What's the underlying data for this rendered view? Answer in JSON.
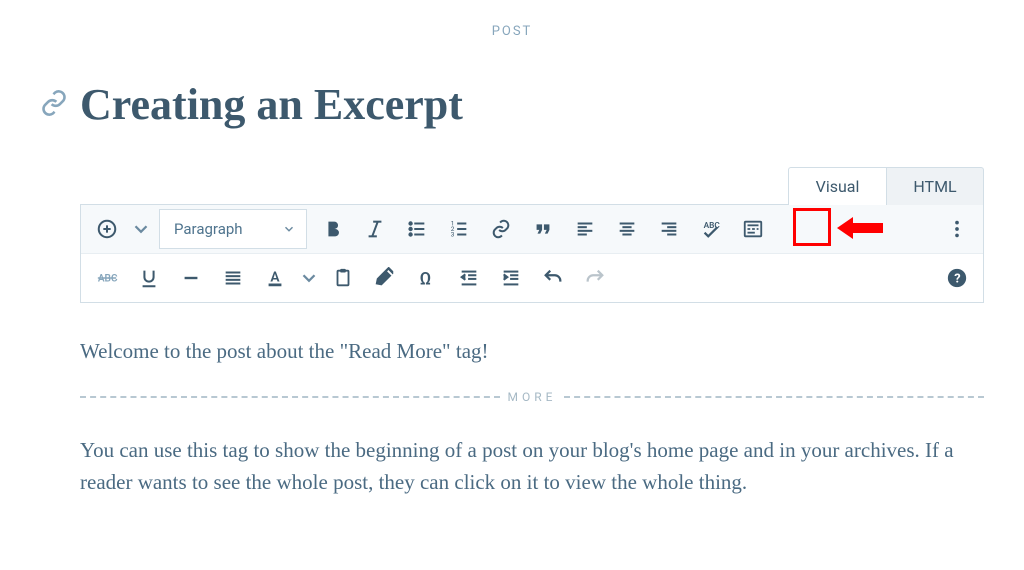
{
  "header": {
    "post_label": "POST"
  },
  "title": "Creating an Excerpt",
  "tabs": {
    "visual": "Visual",
    "html": "HTML"
  },
  "toolbar": {
    "paragraph": "Paragraph"
  },
  "content": {
    "intro": "Welcome to the post about the \"Read More\" tag!",
    "more_label": "MORE",
    "body": "You can use this tag to show the beginning of a post on your blog's home page and in your archives. If a reader wants to see the whole post, they can click on it to view the whole thing."
  }
}
